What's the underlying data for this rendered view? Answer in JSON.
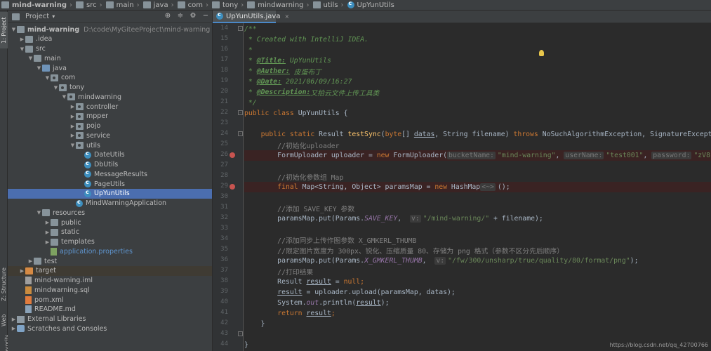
{
  "breadcrumb": [
    {
      "label": "mind-warning",
      "bold": true
    },
    {
      "label": "src"
    },
    {
      "label": "main"
    },
    {
      "label": "java"
    },
    {
      "label": "com"
    },
    {
      "label": "tony"
    },
    {
      "label": "mindwarning"
    },
    {
      "label": "utils"
    },
    {
      "label": "UpYunUtils"
    }
  ],
  "side_tabs": {
    "project": "1: Project",
    "structure": "Z: Structure",
    "web": "Web",
    "favorites": "2: Favorites"
  },
  "project_panel": {
    "title": "Project",
    "tools": [
      "globe",
      "collapse",
      "settings",
      "hide"
    ]
  },
  "tree": [
    {
      "label": "mind-warning",
      "hint": "D:\\code\\MyGiteeProject\\mind-warning",
      "depth": 0,
      "arrow": "down",
      "icon": "folder",
      "bold": true
    },
    {
      "label": ".idea",
      "depth": 1,
      "arrow": "right",
      "icon": "folder"
    },
    {
      "label": "src",
      "depth": 1,
      "arrow": "down",
      "icon": "folder"
    },
    {
      "label": "main",
      "depth": 2,
      "arrow": "down",
      "icon": "folder"
    },
    {
      "label": "java",
      "depth": 3,
      "arrow": "down",
      "icon": "folder-blue"
    },
    {
      "label": "com",
      "depth": 4,
      "arrow": "down",
      "icon": "pkg"
    },
    {
      "label": "tony",
      "depth": 5,
      "arrow": "down",
      "icon": "pkg"
    },
    {
      "label": "mindwarning",
      "depth": 6,
      "arrow": "down",
      "icon": "pkg"
    },
    {
      "label": "controller",
      "depth": 7,
      "arrow": "right",
      "icon": "pkg"
    },
    {
      "label": "mpper",
      "depth": 7,
      "arrow": "right",
      "icon": "pkg"
    },
    {
      "label": "pojo",
      "depth": 7,
      "arrow": "right",
      "icon": "pkg"
    },
    {
      "label": "service",
      "depth": 7,
      "arrow": "right",
      "icon": "pkg"
    },
    {
      "label": "utils",
      "depth": 7,
      "arrow": "down",
      "icon": "pkg"
    },
    {
      "label": "DateUtils",
      "depth": 8,
      "arrow": "",
      "icon": "cls"
    },
    {
      "label": "DbUtils",
      "depth": 8,
      "arrow": "",
      "icon": "cls"
    },
    {
      "label": "MessageResults",
      "depth": 8,
      "arrow": "",
      "icon": "cls"
    },
    {
      "label": "PageUtils",
      "depth": 8,
      "arrow": "",
      "icon": "cls"
    },
    {
      "label": "UpYunUtils",
      "depth": 8,
      "arrow": "",
      "icon": "cls",
      "selected": true
    },
    {
      "label": "MindWarningApplication",
      "depth": 7,
      "arrow": "",
      "icon": "cls"
    },
    {
      "label": "resources",
      "depth": 3,
      "arrow": "down",
      "icon": "folder"
    },
    {
      "label": "public",
      "depth": 4,
      "arrow": "right",
      "icon": "folder"
    },
    {
      "label": "static",
      "depth": 4,
      "arrow": "right",
      "icon": "folder"
    },
    {
      "label": "templates",
      "depth": 4,
      "arrow": "right",
      "icon": "folder"
    },
    {
      "label": "application.properties",
      "depth": 4,
      "arrow": "",
      "icon": "file-prop",
      "blue": true
    },
    {
      "label": "test",
      "depth": 2,
      "arrow": "right",
      "icon": "folder"
    },
    {
      "label": "target",
      "depth": 1,
      "arrow": "right",
      "icon": "folder-orange",
      "target": true
    },
    {
      "label": "mind-warning.iml",
      "depth": 1,
      "arrow": "",
      "icon": "file-iml"
    },
    {
      "label": "mindwarning.sql",
      "depth": 1,
      "arrow": "",
      "icon": "file-sql"
    },
    {
      "label": "pom.xml",
      "depth": 1,
      "arrow": "",
      "icon": "file-xml"
    },
    {
      "label": "README.md",
      "depth": 1,
      "arrow": "",
      "icon": "file-md"
    },
    {
      "label": "External Libraries",
      "depth": 0,
      "arrow": "right",
      "icon": "lib"
    },
    {
      "label": "Scratches and Consoles",
      "depth": 0,
      "arrow": "right",
      "icon": "scratch"
    }
  ],
  "editor_tab": {
    "label": "UpYunUtils.java",
    "close": "×"
  },
  "line_numbers": [
    "14",
    "15",
    "16",
    "17",
    "18",
    "19",
    "20",
    "21",
    "22",
    "23",
    "24",
    "25",
    "26",
    "27",
    "28",
    "29",
    "30",
    "31",
    "32",
    "33",
    "34",
    "35",
    "36",
    "37",
    "38",
    "39",
    "40",
    "41",
    "42",
    "43",
    "44"
  ],
  "breakpoint_lines": [
    "26",
    "29"
  ],
  "code_lines": [
    [
      {
        "t": "/**",
        "c": "doc"
      }
    ],
    [
      {
        "t": " * Created with IntelliJ IDEA.",
        "c": "doc"
      }
    ],
    [
      {
        "t": " *",
        "c": "doc"
      }
    ],
    [
      {
        "t": " * ",
        "c": "doc"
      },
      {
        "t": "@Title:",
        "c": "doctag"
      },
      {
        "t": " UpYunUtils",
        "c": "doc"
      }
    ],
    [
      {
        "t": " * ",
        "c": "doc"
      },
      {
        "t": "@Auther:",
        "c": "doctag"
      },
      {
        "t": " 皮蛋布丁",
        "c": "doc"
      }
    ],
    [
      {
        "t": " * ",
        "c": "doc"
      },
      {
        "t": "@Date:",
        "c": "doctag"
      },
      {
        "t": " 2021/06/09/16:27",
        "c": "doc"
      }
    ],
    [
      {
        "t": " * ",
        "c": "doc"
      },
      {
        "t": "@Description:",
        "c": "doctag"
      },
      {
        "t": "又拍云文件上传工具类",
        "c": "doc"
      }
    ],
    [
      {
        "t": " */",
        "c": "doc"
      }
    ],
    [
      {
        "t": "public class ",
        "c": "kw"
      },
      {
        "t": "UpYunUtils {",
        "c": ""
      }
    ],
    [],
    [
      {
        "t": "    public static ",
        "c": "kw"
      },
      {
        "t": "Result ",
        "c": ""
      },
      {
        "t": "testSync",
        "c": "fn"
      },
      {
        "t": "(",
        "c": ""
      },
      {
        "t": "byte",
        "c": "kw"
      },
      {
        "t": "[] ",
        "c": ""
      },
      {
        "t": "datas",
        "c": "ul"
      },
      {
        "t": ", String filename) ",
        "c": ""
      },
      {
        "t": "throws ",
        "c": "kw"
      },
      {
        "t": "NoSuchAlgorithmException, SignatureException,",
        "c": ""
      }
    ],
    [
      {
        "t": "        //初始化uploader",
        "c": "cmt"
      }
    ],
    [
      {
        "t": "        FormUploader uploader = ",
        "c": ""
      },
      {
        "t": "new ",
        "c": "kw"
      },
      {
        "t": "FormUploader(",
        "c": ""
      },
      {
        "t": "bucketName:",
        "c": "hint"
      },
      {
        "t": "\"mind-warning\"",
        "c": "str"
      },
      {
        "t": ", ",
        "c": ""
      },
      {
        "t": "userName:",
        "c": "hint"
      },
      {
        "t": "\"test001\"",
        "c": "str"
      },
      {
        "t": ", ",
        "c": ""
      },
      {
        "t": "password:",
        "c": "hint"
      },
      {
        "t": "\"zV8L02Tz",
        "c": "str"
      }
    ],
    [],
    [
      {
        "t": "        //初始化参数组 Map",
        "c": "cmt"
      }
    ],
    [
      {
        "t": "        ",
        "c": ""
      },
      {
        "t": "final ",
        "c": "kw"
      },
      {
        "t": "Map<String, Object> paramsMap = ",
        "c": ""
      },
      {
        "t": "new ",
        "c": "kw"
      },
      {
        "t": "HashMap",
        "c": ""
      },
      {
        "t": "<~>",
        "c": "hint"
      },
      {
        "t": "();",
        "c": ""
      }
    ],
    [],
    [
      {
        "t": "        //添加 SAVE_KEY 参数",
        "c": "cmt"
      }
    ],
    [
      {
        "t": "        paramsMap.put(Params.",
        "c": ""
      },
      {
        "t": "SAVE_KEY",
        "c": "static"
      },
      {
        "t": ",  ",
        "c": ""
      },
      {
        "t": "v:",
        "c": "hint"
      },
      {
        "t": "\"/mind-warning/\"",
        "c": "str"
      },
      {
        "t": " + filename);",
        "c": ""
      }
    ],
    [],
    [
      {
        "t": "        //添加同步上传作图参数 X_GMKERL_THUMB",
        "c": "cmt"
      }
    ],
    [
      {
        "t": "        //限定图片宽度为 300px、锐化、压缩质量 80、存储为 png 格式（参数不区分先后顺序）",
        "c": "cmt"
      }
    ],
    [
      {
        "t": "        paramsMap.put(Params.",
        "c": ""
      },
      {
        "t": "X_GMKERL_THUMB",
        "c": "static"
      },
      {
        "t": ",  ",
        "c": ""
      },
      {
        "t": "v:",
        "c": "hint"
      },
      {
        "t": "\"/fw/300/unsharp/true/quality/80/format/png\"",
        "c": "str"
      },
      {
        "t": ");",
        "c": ""
      }
    ],
    [
      {
        "t": "        //打印结果",
        "c": "cmt"
      }
    ],
    [
      {
        "t": "        Result ",
        "c": ""
      },
      {
        "t": "result",
        "c": "ul"
      },
      {
        "t": " = ",
        "c": ""
      },
      {
        "t": "null",
        "c": "kw"
      },
      {
        "t": ";",
        "c": "kw"
      }
    ],
    [
      {
        "t": "        ",
        "c": ""
      },
      {
        "t": "result",
        "c": "ul"
      },
      {
        "t": " = uploader.upload(paramsMap, datas);",
        "c": ""
      }
    ],
    [
      {
        "t": "        System.",
        "c": ""
      },
      {
        "t": "out",
        "c": "static"
      },
      {
        "t": ".println(",
        "c": ""
      },
      {
        "t": "result",
        "c": "ul"
      },
      {
        "t": ");",
        "c": ""
      }
    ],
    [
      {
        "t": "        ",
        "c": ""
      },
      {
        "t": "return ",
        "c": "kw"
      },
      {
        "t": "result",
        "c": "ul"
      },
      {
        "t": ";",
        "c": "kw"
      }
    ],
    [
      {
        "t": "    }",
        "c": ""
      }
    ],
    [],
    [
      {
        "t": "}",
        "c": ""
      }
    ]
  ],
  "watermark": "https://blog.csdn.net/qq_42700766",
  "colors": {
    "background": "#2b2b2b",
    "panel": "#3c3f41",
    "selection": "#4b6eaf",
    "keyword": "#cc7832",
    "string": "#6a8759",
    "comment": "#808080",
    "doc": "#629755",
    "breakpoint": "#c75450"
  }
}
